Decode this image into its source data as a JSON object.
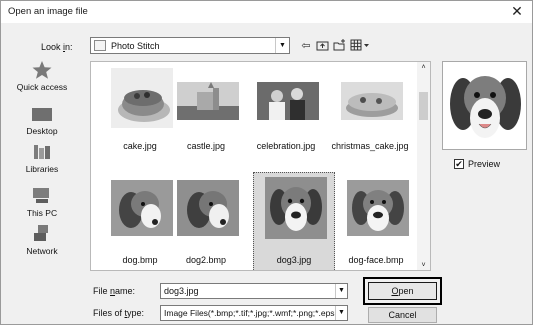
{
  "window": {
    "title": "Open an image file",
    "close_glyph": "✕"
  },
  "lookin": {
    "label_pre": "Look ",
    "label_ul": "i",
    "label_post": "n:",
    "value": "Photo Stitch",
    "arrow": "▼"
  },
  "toolbar": [
    {
      "name": "back-icon",
      "glyph": "⇦"
    },
    {
      "name": "up-folder-icon",
      "glyph": "⮤"
    },
    {
      "name": "new-folder-icon",
      "glyph": "✳"
    },
    {
      "name": "view-menu-icon",
      "glyph": "▦▾"
    }
  ],
  "places": [
    {
      "name": "quick-access",
      "label": "Quick access",
      "icon": "star-icon"
    },
    {
      "name": "desktop",
      "label": "Desktop",
      "icon": "desktop-icon"
    },
    {
      "name": "libraries",
      "label": "Libraries",
      "icon": "libraries-icon"
    },
    {
      "name": "this-pc",
      "label": "This PC",
      "icon": "computer-icon"
    },
    {
      "name": "network",
      "label": "Network",
      "icon": "network-icon"
    }
  ],
  "files": [
    {
      "name": "cake.jpg",
      "kind": "cake"
    },
    {
      "name": "castle.jpg",
      "kind": "castle"
    },
    {
      "name": "celebration.jpg",
      "kind": "celebration"
    },
    {
      "name": "christmas_cake.jpg",
      "kind": "xmas"
    },
    {
      "name": "dog.bmp",
      "kind": "dog"
    },
    {
      "name": "dog2.bmp",
      "kind": "dog"
    },
    {
      "name": "dog3.jpg",
      "kind": "dog",
      "selected": true
    },
    {
      "name": "dog-face.bmp",
      "kind": "dog"
    }
  ],
  "scroll": {
    "up": "˄",
    "down": "˅"
  },
  "preview": {
    "label": "Preview",
    "checked": true,
    "check_glyph": "✔"
  },
  "filename": {
    "label_pre": "File ",
    "label_ul": "n",
    "label_post": "ame:",
    "value": "dog3.jpg"
  },
  "filetype": {
    "label_pre": "Files of ",
    "label_ul": "t",
    "label_post": "ype:",
    "value": "Image Files(*.bmp;*.tif;*.jpg;*.wmf;*.png;*.eps;*.c"
  },
  "buttons": {
    "open_ul": "O",
    "open_rest": "pen",
    "cancel": "Cancel"
  }
}
